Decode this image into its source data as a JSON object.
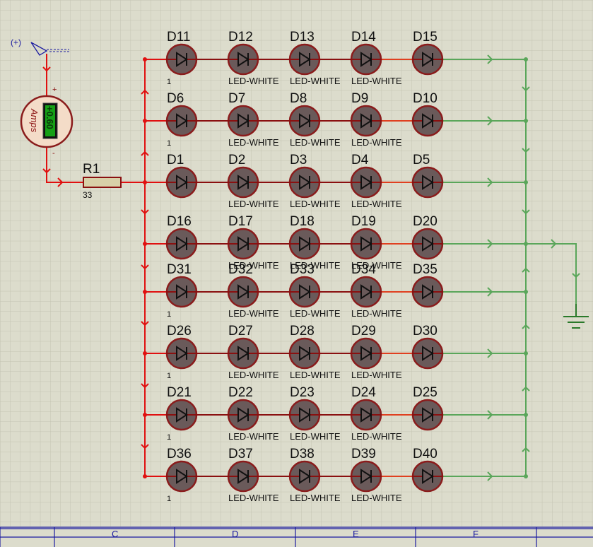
{
  "colors": {
    "background": "#dcdccc",
    "grid": "#c4c4b2",
    "wire_live": "#e01010",
    "wire_dark": "#8a1010",
    "wire_green": "#5aa65a",
    "led_body": "#6a5a5a",
    "led_ring": "#8a1c1c",
    "text": "#111111",
    "meter_face": "#f4dcc8",
    "meter_text": "#8a1010",
    "meter_display": "#16a016",
    "frame": "#1a1aa0",
    "ground": "#2a7a2a"
  },
  "probe": {
    "label": "(+)"
  },
  "ammeter": {
    "unit_label": "Amps",
    "reading": "+0.60",
    "plus_label": "+",
    "minus_label": "-"
  },
  "resistor": {
    "ref": "R1",
    "value": "33"
  },
  "led_rows": [
    {
      "refs": [
        "D11",
        "D12",
        "D13",
        "D14",
        "D15"
      ],
      "sublabels": [
        "1",
        "LED-WHITE",
        "LED-WHITE",
        "LED-WHITE",
        ""
      ]
    },
    {
      "refs": [
        "D6",
        "D7",
        "D8",
        "D9",
        "D10"
      ],
      "sublabels": [
        "1",
        "LED-WHITE",
        "LED-WHITE",
        "LED-WHITE",
        ""
      ]
    },
    {
      "refs": [
        "D1",
        "D2",
        "D3",
        "D4",
        "D5"
      ],
      "sublabels": [
        "",
        "LED-WHITE",
        "LED-WHITE",
        "LED-WHITE",
        ""
      ]
    },
    {
      "refs": [
        "D16",
        "D17",
        "D18",
        "D19",
        "D20"
      ],
      "sublabels": [
        "",
        "LED-WHITE",
        "LED-WHITE",
        "LED-WHITE",
        ""
      ]
    },
    {
      "refs": [
        "D31",
        "D32",
        "D33",
        "D34",
        "D35"
      ],
      "sublabels": [
        "1",
        "LED-WHITE",
        "LED-WHITE",
        "LED-WHITE",
        ""
      ]
    },
    {
      "refs": [
        "D26",
        "D27",
        "D28",
        "D29",
        "D30"
      ],
      "sublabels": [
        "1",
        "LED-WHITE",
        "LED-WHITE",
        "LED-WHITE",
        ""
      ]
    },
    {
      "refs": [
        "D21",
        "D22",
        "D23",
        "D24",
        "D25"
      ],
      "sublabels": [
        "1",
        "LED-WHITE",
        "LED-WHITE",
        "LED-WHITE",
        ""
      ]
    },
    {
      "refs": [
        "D36",
        "D37",
        "D38",
        "D39",
        "D40"
      ],
      "sublabels": [
        "1",
        "LED-WHITE",
        "LED-WHITE",
        "LED-WHITE",
        ""
      ]
    }
  ],
  "frame_columns": [
    "C",
    "D",
    "E",
    "F"
  ]
}
